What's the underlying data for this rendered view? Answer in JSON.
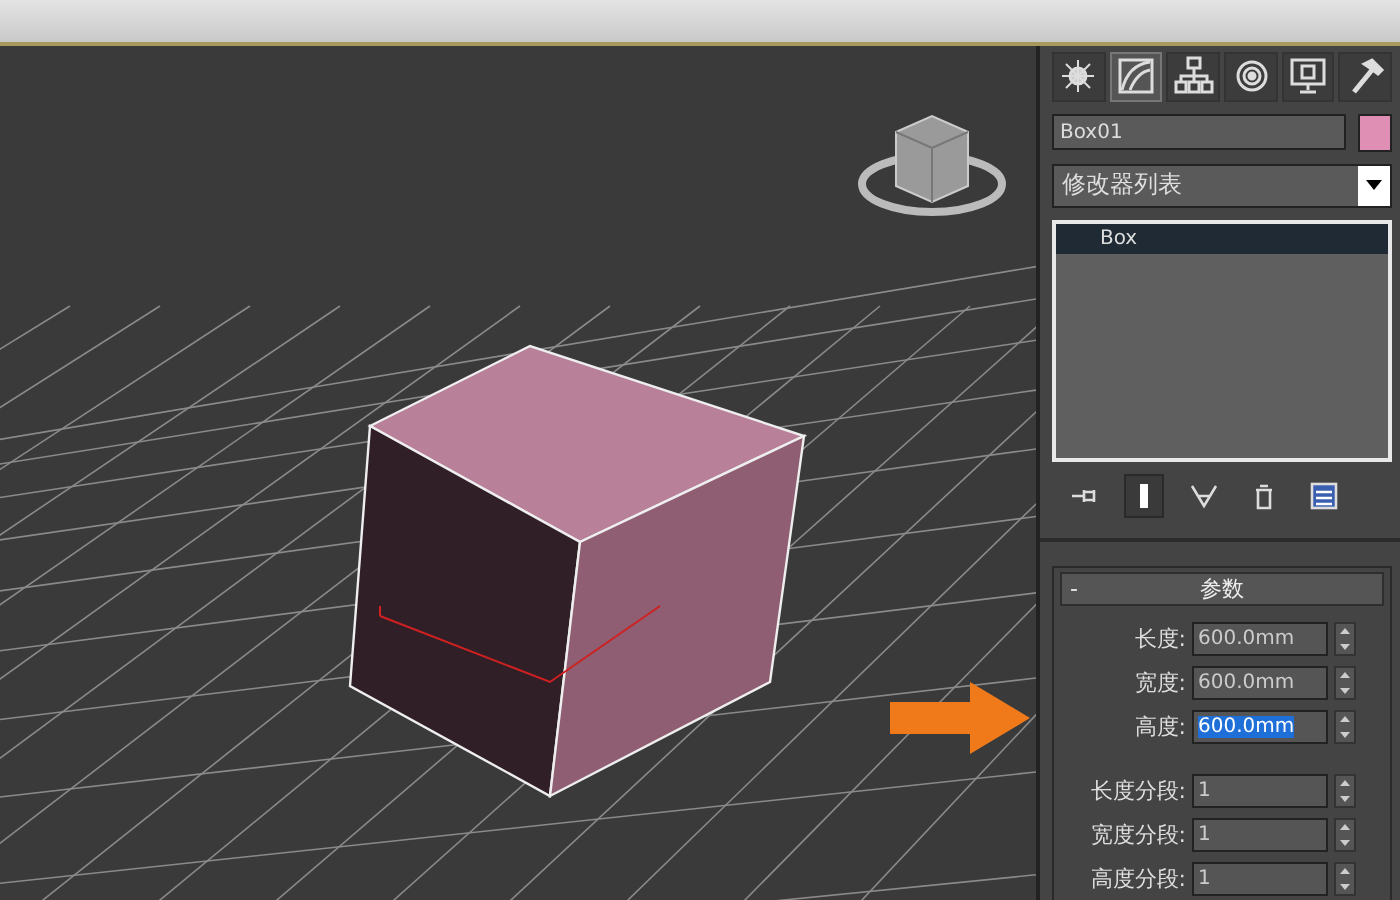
{
  "command_panel": {
    "tabs": [
      {
        "kind": "create",
        "selected": false
      },
      {
        "kind": "modify",
        "selected": true
      },
      {
        "kind": "hierarchy",
        "selected": false
      },
      {
        "kind": "motion",
        "selected": false
      },
      {
        "kind": "display",
        "selected": false
      },
      {
        "kind": "utilities",
        "selected": false
      }
    ],
    "object": {
      "name": "Box01",
      "color": "#e08fb4"
    },
    "modifier_list": "修改器列表",
    "modifier_stack": [
      {
        "label": "Box",
        "selected": true
      }
    ],
    "stack_tools": [
      {
        "kind": "pin",
        "on": false
      },
      {
        "kind": "show-end",
        "on": true
      },
      {
        "kind": "unique",
        "on": false
      },
      {
        "kind": "remove",
        "on": false
      },
      {
        "kind": "configure",
        "on": false
      }
    ],
    "rollout": {
      "title": "参数",
      "collapse": "-",
      "params": [
        {
          "label": "长度:",
          "value": "600.0mm",
          "focused": false
        },
        {
          "label": "宽度:",
          "value": "600.0mm",
          "focused": false
        },
        {
          "label": "高度:",
          "value": "600.0mm",
          "focused": true
        },
        {
          "label": "长度分段:",
          "value": "1",
          "focused": false
        },
        {
          "label": "宽度分段:",
          "value": "1",
          "focused": false
        },
        {
          "label": "高度分段:",
          "value": "1",
          "focused": false
        }
      ]
    }
  }
}
